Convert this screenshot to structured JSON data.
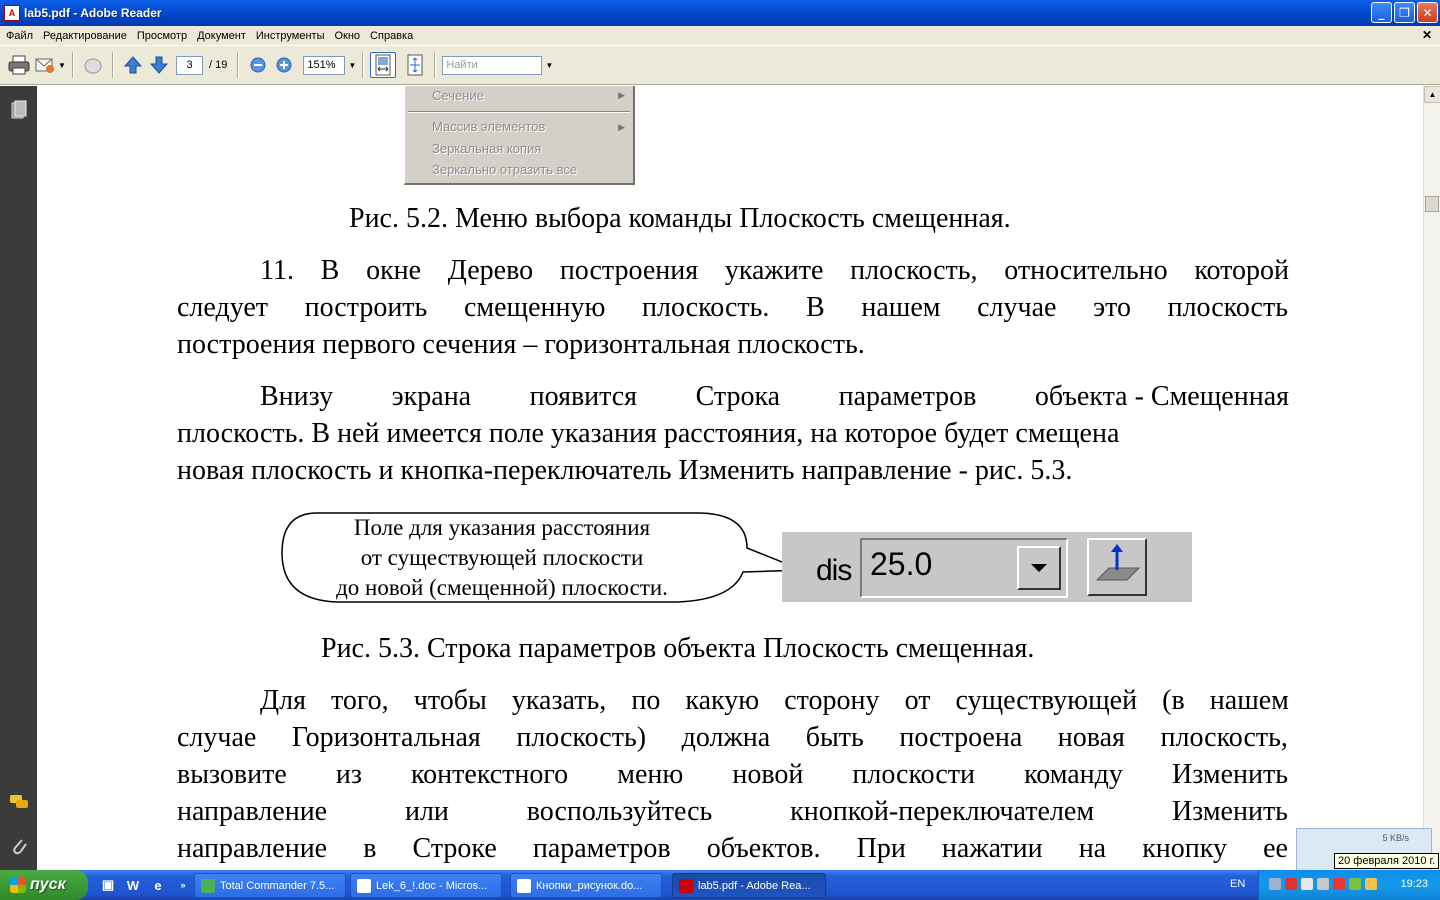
{
  "window": {
    "title": "lab5.pdf - Adobe Reader",
    "buttons": {
      "minimize": "_",
      "maximize": "❐",
      "close": "✕"
    }
  },
  "menu": [
    "Файл",
    "Редактирование",
    "Просмотр",
    "Документ",
    "Инструменты",
    "Окно",
    "Справка"
  ],
  "toolbar": {
    "page_current": "3",
    "page_total": "/ 19",
    "zoom": "151%",
    "search_placeholder": "Найти"
  },
  "document": {
    "menu_image": {
      "items": [
        "Сечение",
        "Массив элементов",
        "Зеркальная копия",
        "Зеркально отразить все"
      ]
    },
    "caption_1": "Рис. 5.2. Меню выбора команды Плоскость смещенная.",
    "para_11": {
      "line1_words": [
        "11.",
        "В",
        "окне",
        "Дерево",
        "построения",
        "укажите",
        "плоскость,",
        "относительно",
        "которой"
      ],
      "line2_words": [
        "следует",
        "построить",
        "смещенную",
        "плоскость.",
        "В",
        "нашем",
        "случае",
        "это",
        "плоскость"
      ],
      "line3": "построения первого сечения – горизонтальная плоскость."
    },
    "para_bottom": {
      "line1_words": [
        "Внизу",
        "экрана",
        "появится",
        "Строка",
        "параметров",
        "объекта - Смещенная"
      ],
      "line2": "плоскость. В ней имеется поле указания расстояния, на которое будет смещена",
      "line3": "новая плоскость и кнопка-переключатель Изменить направление - рис. 5.3."
    },
    "callout": {
      "line1": "Поле для указания расстояния",
      "line2": "от существующей плоскости",
      "line3": "до новой (смещенной) плоскости."
    },
    "param_bar": {
      "label": "dis",
      "value": "25.0"
    },
    "caption_2": "Рис. 5.3. Строка параметров объекта Плоскость смещенная.",
    "para_last": {
      "line1_words": [
        "Для",
        "того,",
        "чтобы",
        "указать,",
        "по",
        "какую",
        "сторону",
        "от",
        "существующей",
        "(в",
        "нашем"
      ],
      "line2_words": [
        "случае",
        "Горизонтальная",
        "плоскость)",
        "должна",
        "быть",
        "построена",
        "новая",
        "плоскость,"
      ],
      "line3_words": [
        "вызовите",
        "из",
        "контекстного",
        "меню",
        "новой",
        "плоскости",
        "команду",
        "Изменить"
      ],
      "line4_words": [
        "направление",
        "или",
        "воспользуйтесь",
        "кнопкой-переключателем",
        "Изменить"
      ],
      "line5_words": [
        "направление",
        "в",
        "Строке",
        "параметров",
        "объектов.",
        "При",
        "нажатии",
        "на",
        "кнопку",
        "ее"
      ]
    }
  },
  "tray_widget": {
    "speed": "5 KB/s",
    "tooltip": "20 февраля 2010 г."
  },
  "taskbar": {
    "start": "пуск",
    "tasks": [
      "Total Commander 7.5...",
      "Lek_6_!.doc - Micros...",
      "Кнопки_рисунок.do...",
      "lab5.pdf - Adobe Rea..."
    ],
    "lang": "EN",
    "clock": "19:23"
  }
}
